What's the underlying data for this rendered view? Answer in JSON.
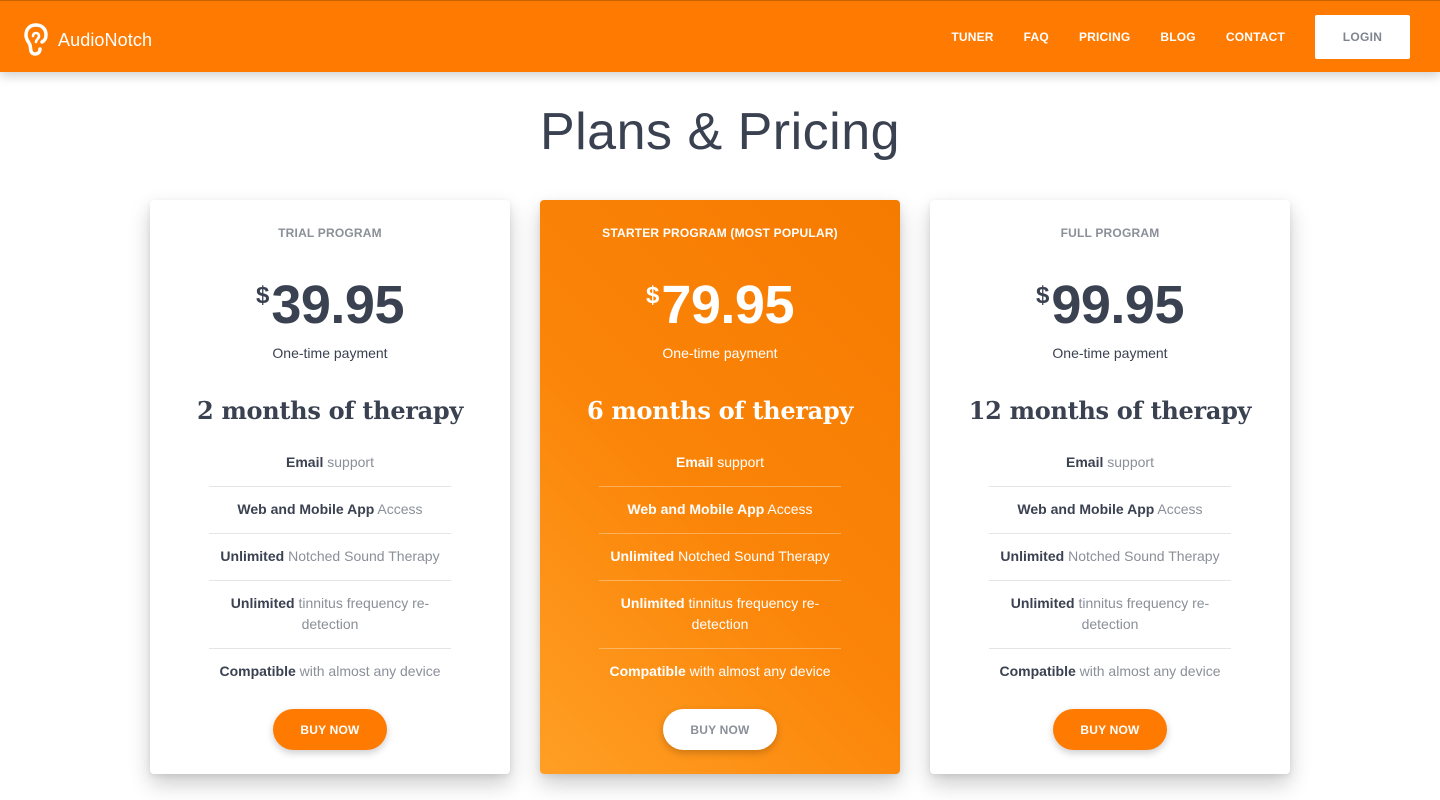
{
  "header": {
    "brand": "AudioNotch",
    "logo_icon": "ear-icon",
    "nav": [
      "TUNER",
      "FAQ",
      "PRICING",
      "BLOG",
      "CONTACT"
    ],
    "login_label": "LOGIN"
  },
  "colors": {
    "brand_orange": "#ff7a00",
    "text_dark": "#3a4150",
    "text_muted": "#8a8f98",
    "white": "#ffffff"
  },
  "page_title": "Plans & Pricing",
  "plans": [
    {
      "name": "TRIAL PROGRAM",
      "currency": "$",
      "price": "39.95",
      "payment": "One-time payment",
      "duration": "2 months of therapy",
      "features": [
        {
          "strong": "Email",
          "rest": " support"
        },
        {
          "strong": "Web and Mobile App",
          "rest": " Access"
        },
        {
          "strong": "Unlimited",
          "rest": " Notched Sound Therapy"
        },
        {
          "strong": "Unlimited",
          "rest": " tinnitus frequency re-detection"
        },
        {
          "strong": "Compatible",
          "rest": " with almost any device"
        }
      ],
      "button": "BUY NOW"
    },
    {
      "name": "STARTER PROGRAM (MOST POPULAR)",
      "currency": "$",
      "price": "79.95",
      "payment": "One-time payment",
      "duration": "6 months of therapy",
      "features": [
        {
          "strong": "Email",
          "rest": " support"
        },
        {
          "strong": "Web and Mobile App",
          "rest": " Access"
        },
        {
          "strong": "Unlimited",
          "rest": " Notched Sound Therapy"
        },
        {
          "strong": "Unlimited",
          "rest": " tinnitus frequency re-detection"
        },
        {
          "strong": "Compatible",
          "rest": " with almost any device"
        }
      ],
      "button": "BUY NOW"
    },
    {
      "name": "FULL PROGRAM",
      "currency": "$",
      "price": "99.95",
      "payment": "One-time payment",
      "duration": "12 months of therapy",
      "features": [
        {
          "strong": "Email",
          "rest": " support"
        },
        {
          "strong": "Web and Mobile App",
          "rest": " Access"
        },
        {
          "strong": "Unlimited",
          "rest": " Notched Sound Therapy"
        },
        {
          "strong": "Unlimited",
          "rest": " tinnitus frequency re-detection"
        },
        {
          "strong": "Compatible",
          "rest": " with almost any device"
        }
      ],
      "button": "BUY NOW"
    }
  ]
}
